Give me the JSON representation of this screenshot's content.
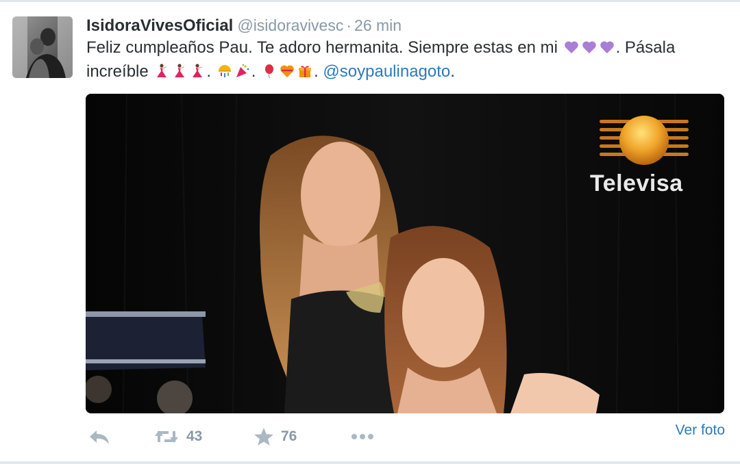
{
  "tweet": {
    "display_name": "IsidoraVivesOficial",
    "handle": "@isidoravivesc",
    "separator": "·",
    "timestamp": "26 min",
    "text_part1": "Feliz cumpleaños Pau. Te adoro hermanita. Siempre estas en mi",
    "text_part2": ". Pásala increíble",
    "text_part3": ".",
    "text_part4": ".",
    "text_part5": ".",
    "mention": "@soypaulinagoto",
    "text_end": ".",
    "emoji": [
      "purple-heart",
      "purple-heart",
      "purple-heart",
      "dancer",
      "dancer",
      "dancer",
      "confetti-ball",
      "party-popper",
      "balloon",
      "gift-heart",
      "wrapped-gift"
    ]
  },
  "media": {
    "watermark": "Televisa"
  },
  "actions": {
    "retweet_count": "43",
    "favorite_count": "76",
    "view_photo": "Ver foto"
  },
  "colors": {
    "name": "#292f33",
    "muted": "#8899a6",
    "link": "#2b7bb9",
    "action_icon": "#aab8c2",
    "heart": "#a97fd6"
  }
}
